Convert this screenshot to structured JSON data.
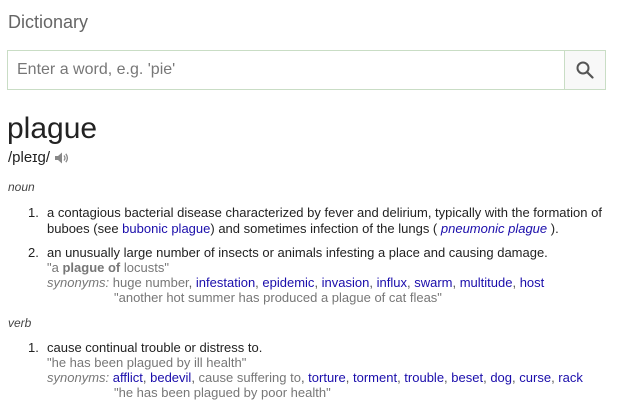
{
  "header": {
    "title": "Dictionary"
  },
  "search": {
    "placeholder": "Enter a word, e.g. 'pie'",
    "value": ""
  },
  "entry": {
    "word": "plague",
    "pronunciation": "/pleɪɡ/",
    "noun": {
      "pos": "noun",
      "senses": [
        {
          "number": "1.",
          "def_part1": "a contagious bacterial disease characterized by fever and delirium, typically with the formation of buboes (see ",
          "def_link1": "bubonic plague",
          "def_part2": ") and sometimes infection of the lungs (",
          "def_link2": "pneumonic plague",
          "def_part3": ")."
        },
        {
          "number": "2.",
          "definition": "an unusually large number of insects or animals infesting a place and causing damage.",
          "example_open": "\"a ",
          "example_bold": "plague of",
          "example_close": " locusts\"",
          "synonyms_label": "synonyms:",
          "synonyms": [
            {
              "text": "huge number",
              "link": false
            },
            {
              "text": "infestation",
              "link": true
            },
            {
              "text": "epidemic",
              "link": true
            },
            {
              "text": "invasion",
              "link": true
            },
            {
              "text": "influx",
              "link": true
            },
            {
              "text": "swarm",
              "link": true
            },
            {
              "text": "multitude",
              "link": true
            },
            {
              "text": "host",
              "link": true
            }
          ],
          "synonym_example": "\"another hot summer has produced a plague of cat fleas\""
        }
      ]
    },
    "verb": {
      "pos": "verb",
      "senses": [
        {
          "number": "1.",
          "definition": "cause continual trouble or distress to.",
          "example": "\"he has been plagued by ill health\"",
          "synonyms_label": "synonyms:",
          "synonyms": [
            {
              "text": "afflict",
              "link": true
            },
            {
              "text": "bedevil",
              "link": true
            },
            {
              "text": "cause suffering to",
              "link": false
            },
            {
              "text": "torture",
              "link": true
            },
            {
              "text": "torment",
              "link": true
            },
            {
              "text": "trouble",
              "link": true
            },
            {
              "text": "beset",
              "link": true
            },
            {
              "text": "dog",
              "link": true
            },
            {
              "text": "curse",
              "link": true
            },
            {
              "text": "rack",
              "link": true
            }
          ],
          "synonym_example": "\"he has been plagued by poor health\""
        }
      ]
    }
  }
}
